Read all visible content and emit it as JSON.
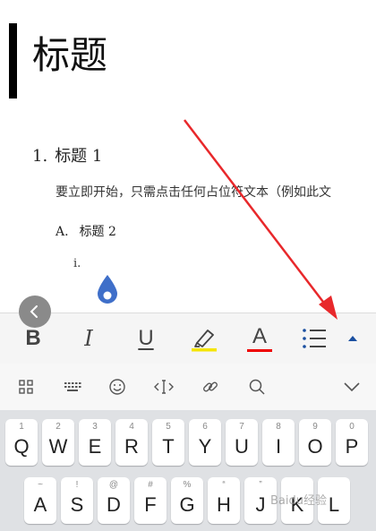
{
  "document": {
    "title": "标题",
    "heading1_number": "1.",
    "heading1_text": "标题 1",
    "body_text": "要立即开始，只需点击任何占位符文本（例如此文",
    "heading2_number": "A.",
    "heading2_text": "标题 2",
    "heading3_number": "i."
  },
  "format_toolbar": {
    "bold": "B",
    "italic": "I",
    "underline": "U",
    "font_color": "A",
    "highlight_color": "#f5e500",
    "font_color_bar": "#e00000",
    "icons": [
      "back-chevron-icon",
      "highlighter-icon",
      "bullet-list-icon",
      "expand-up-icon"
    ]
  },
  "keyboard_toolbar": {
    "icons": [
      "grid-icon",
      "keyboard-icon",
      "emoji-icon",
      "cursor-move-icon",
      "link-icon",
      "search-icon",
      "collapse-keyboard-icon"
    ]
  },
  "keyboard": {
    "row1": [
      {
        "hint": "1",
        "key": "Q"
      },
      {
        "hint": "2",
        "key": "W"
      },
      {
        "hint": "3",
        "key": "E"
      },
      {
        "hint": "4",
        "key": "R"
      },
      {
        "hint": "5",
        "key": "T"
      },
      {
        "hint": "6",
        "key": "Y"
      },
      {
        "hint": "7",
        "key": "U"
      },
      {
        "hint": "8",
        "key": "I"
      },
      {
        "hint": "9",
        "key": "O"
      },
      {
        "hint": "0",
        "key": "P"
      }
    ],
    "row2": [
      {
        "hint": "~",
        "key": "A"
      },
      {
        "hint": "!",
        "key": "S"
      },
      {
        "hint": "@",
        "key": "D"
      },
      {
        "hint": "#",
        "key": "F"
      },
      {
        "hint": "%",
        "key": "G"
      },
      {
        "hint": "“",
        "key": "H"
      },
      {
        "hint": "”",
        "key": "J"
      },
      {
        "hint": "",
        "key": "K"
      },
      {
        "hint": "",
        "key": "L"
      }
    ]
  },
  "watermark": "Baidu经验",
  "accent_arrow_color": "#e8282b"
}
